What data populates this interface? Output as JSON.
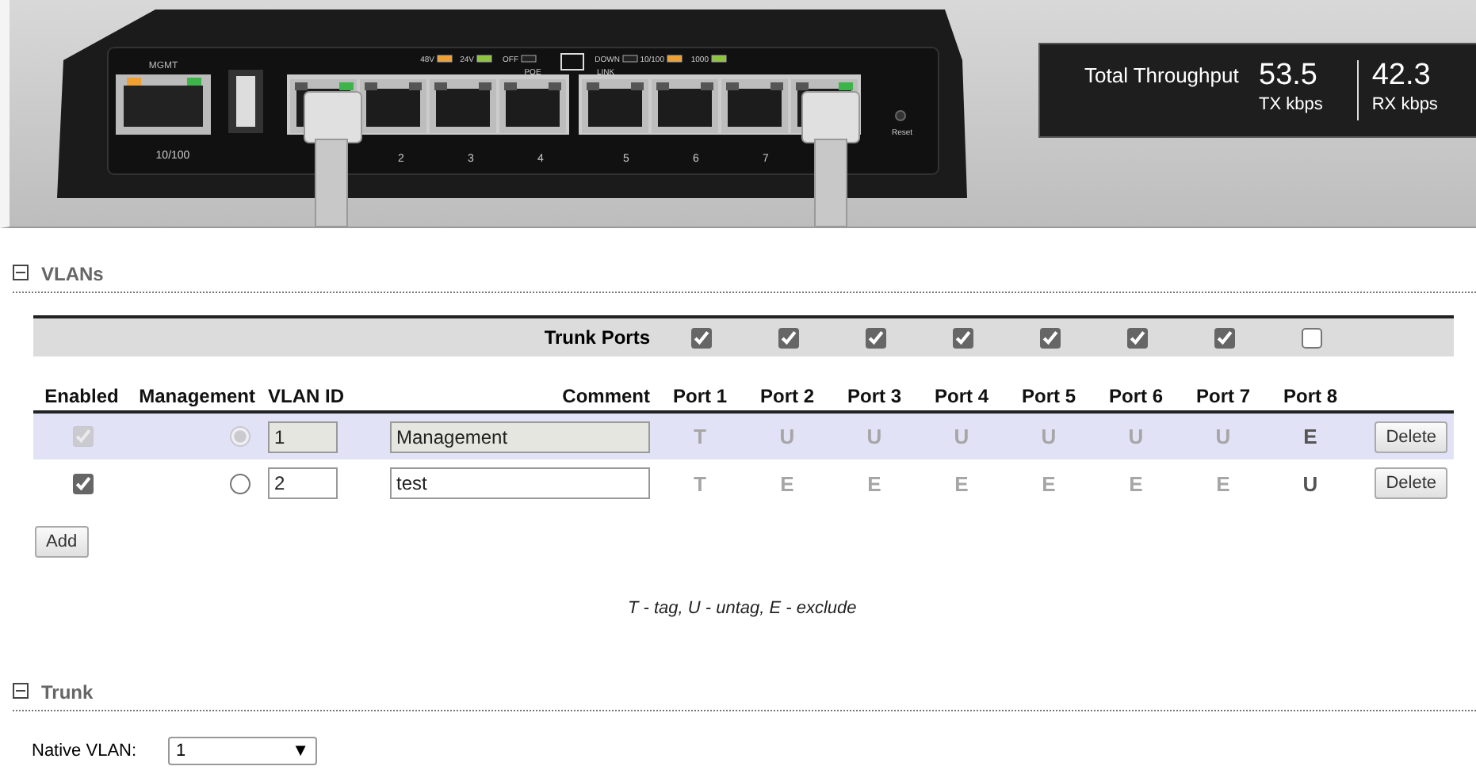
{
  "device": {
    "mgmt_label": "MGMT",
    "mgmt_speed": "10/100",
    "legend": [
      {
        "label": "48V",
        "color": "#f0a030"
      },
      {
        "label": "24V",
        "color": "#8cc43c"
      },
      {
        "label": "OFF",
        "color": "#222222"
      },
      {
        "label": "DOWN",
        "color": "#222222"
      },
      {
        "label": "10/100",
        "color": "#f0a030"
      },
      {
        "label": "1000",
        "color": "#8cc43c"
      }
    ],
    "poe_label": "POE",
    "link_label": "LINK",
    "port_numbers": [
      "2",
      "3",
      "4",
      "5",
      "6",
      "7"
    ],
    "reset_label": "Reset"
  },
  "throughput": {
    "title": "Total Throughput",
    "tx_value": "53.5",
    "tx_unit": "TX kbps",
    "rx_value": "42.3",
    "rx_unit": "RX kbps"
  },
  "vlans": {
    "title": "VLANs",
    "expanded": true,
    "trunk_label": "Trunk Ports",
    "trunk_ports": [
      {
        "checked": true
      },
      {
        "checked": true
      },
      {
        "checked": true
      },
      {
        "checked": true
      },
      {
        "checked": true
      },
      {
        "checked": true
      },
      {
        "checked": true
      },
      {
        "checked": false
      }
    ],
    "columns": [
      "Enabled",
      "Management",
      "VLAN ID",
      "Comment",
      "Port 1",
      "Port 2",
      "Port 3",
      "Port 4",
      "Port 5",
      "Port 6",
      "Port 7",
      "Port 8"
    ],
    "rows": [
      {
        "selected": true,
        "disabled": true,
        "enabled": true,
        "management": true,
        "vlan_id": "1",
        "comment": "Management",
        "ports": [
          {
            "mode": "T",
            "active": false
          },
          {
            "mode": "U",
            "active": false
          },
          {
            "mode": "U",
            "active": false
          },
          {
            "mode": "U",
            "active": false
          },
          {
            "mode": "U",
            "active": false
          },
          {
            "mode": "U",
            "active": false
          },
          {
            "mode": "U",
            "active": false
          },
          {
            "mode": "E",
            "active": true
          }
        ],
        "delete": "Delete"
      },
      {
        "selected": false,
        "disabled": false,
        "enabled": true,
        "management": false,
        "vlan_id": "2",
        "comment": "test",
        "ports": [
          {
            "mode": "T",
            "active": false
          },
          {
            "mode": "E",
            "active": false
          },
          {
            "mode": "E",
            "active": false
          },
          {
            "mode": "E",
            "active": false
          },
          {
            "mode": "E",
            "active": false
          },
          {
            "mode": "E",
            "active": false
          },
          {
            "mode": "E",
            "active": false
          },
          {
            "mode": "U",
            "active": true
          }
        ],
        "delete": "Delete"
      }
    ],
    "add": "Add",
    "legend": "T - tag, U - untag, E - exclude"
  },
  "trunk": {
    "title": "Trunk",
    "expanded": true,
    "native_label": "Native VLAN:",
    "native_value": "1",
    "arrow": "▼"
  }
}
